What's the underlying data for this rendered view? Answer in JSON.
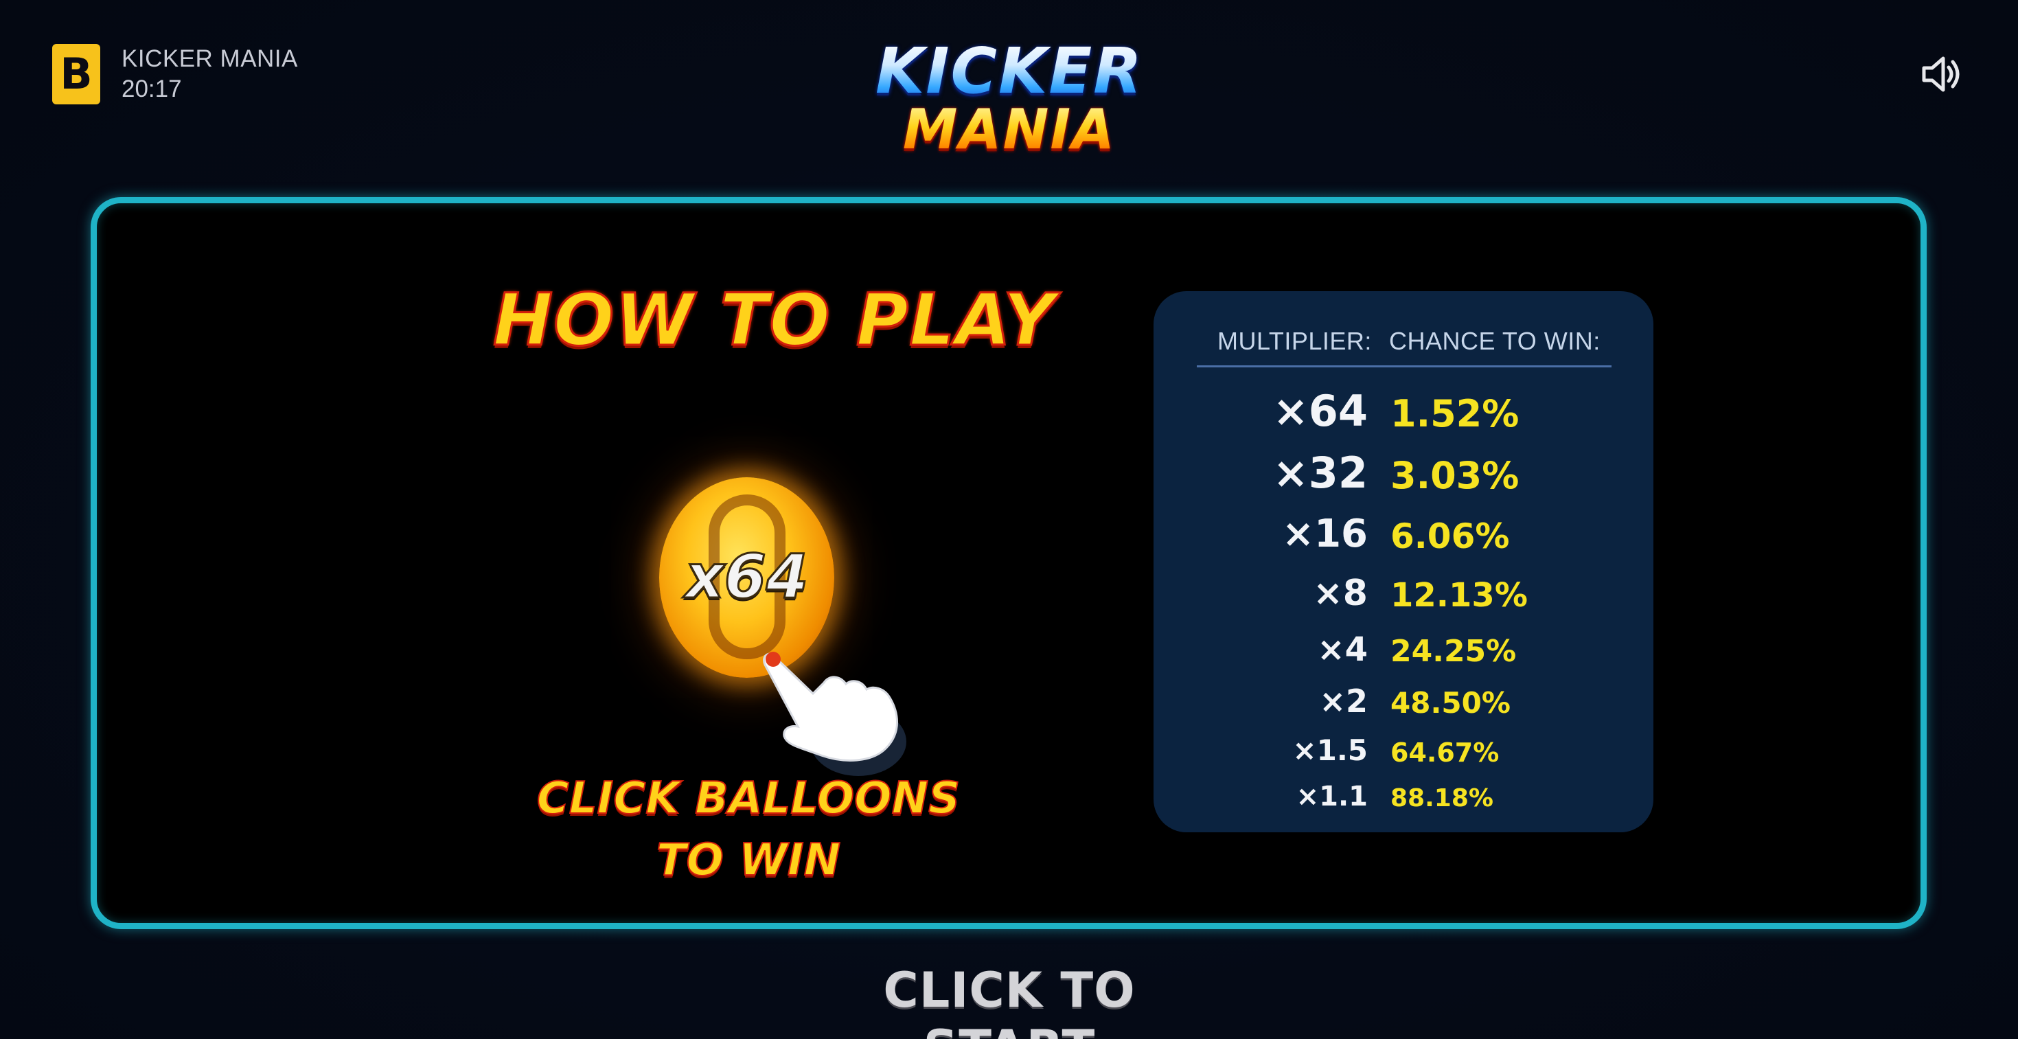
{
  "header": {
    "brand_letter": "B",
    "game_name": "KICKER MANIA",
    "time": "20:17",
    "sound_icon": "speaker-icon"
  },
  "logo": {
    "line1": "KICKER",
    "line2": "MANIA"
  },
  "how_to_play": {
    "title": "HOW TO PLAY",
    "balloon_label": "x64",
    "instruction_line1": "CLICK BALLOONS",
    "instruction_line2": "TO WIN",
    "pointer_icon": "pointing-hand-icon"
  },
  "odds_table": {
    "header_multiplier": "MULTIPLIER:",
    "header_chance": "CHANCE TO WIN:",
    "rows": [
      {
        "multiplier": "×64",
        "chance": "1.52%"
      },
      {
        "multiplier": "×32",
        "chance": "3.03%"
      },
      {
        "multiplier": "×16",
        "chance": "6.06%"
      },
      {
        "multiplier": "×8",
        "chance": "12.13%"
      },
      {
        "multiplier": "×4",
        "chance": "24.25%"
      },
      {
        "multiplier": "×2",
        "chance": "48.50%"
      },
      {
        "multiplier": "×1.5",
        "chance": "64.67%"
      },
      {
        "multiplier": "×1.1",
        "chance": "88.18%"
      }
    ]
  },
  "footer": {
    "start_label": "CLICK TO START"
  },
  "colors": {
    "panel_border": "#1fb3c7",
    "table_bg": "#0b2340",
    "chance_text": "#f6e321",
    "title_fill": "#ffd21a",
    "title_stroke": "#d41f0a"
  }
}
